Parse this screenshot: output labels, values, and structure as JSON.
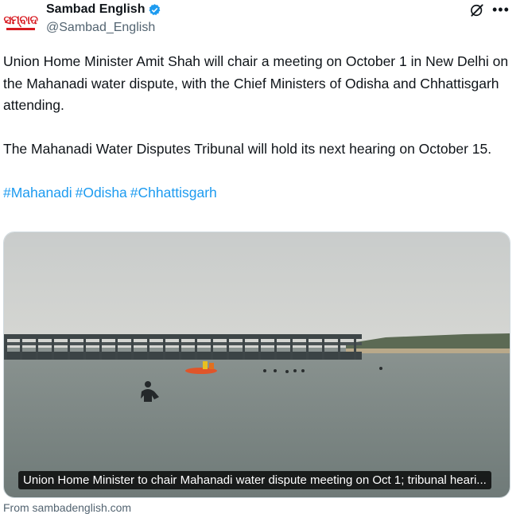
{
  "account": {
    "display_name": "Sambad English",
    "handle": "@Sambad_English",
    "avatar_text": "ସମ୍ବାଦ",
    "verified": true
  },
  "tweet": {
    "paragraph_1": "Union Home Minister Amit Shah will chair a meeting on October 1 in New Delhi on the Mahanadi water dispute, with the Chief Ministers of Odisha and Chhattisgarh attending.",
    "paragraph_2": "The Mahanadi Water Disputes Tribunal will hold its next hearing on October 15.",
    "hashtags": [
      "#Mahanadi",
      "#Odisha",
      "#Chhattisgarh"
    ]
  },
  "card": {
    "caption": "Union Home Minister to chair Mahanadi water dispute meeting on Oct 1; tribunal heari...",
    "source": "From sambadenglish.com"
  },
  "icons": {
    "verified": "verified-badge-icon",
    "grok": "grok-icon",
    "more": "more-options-icon"
  },
  "colors": {
    "link": "#1d9bf0",
    "verified": "#1d9bf0",
    "secondary_text": "#536471"
  }
}
